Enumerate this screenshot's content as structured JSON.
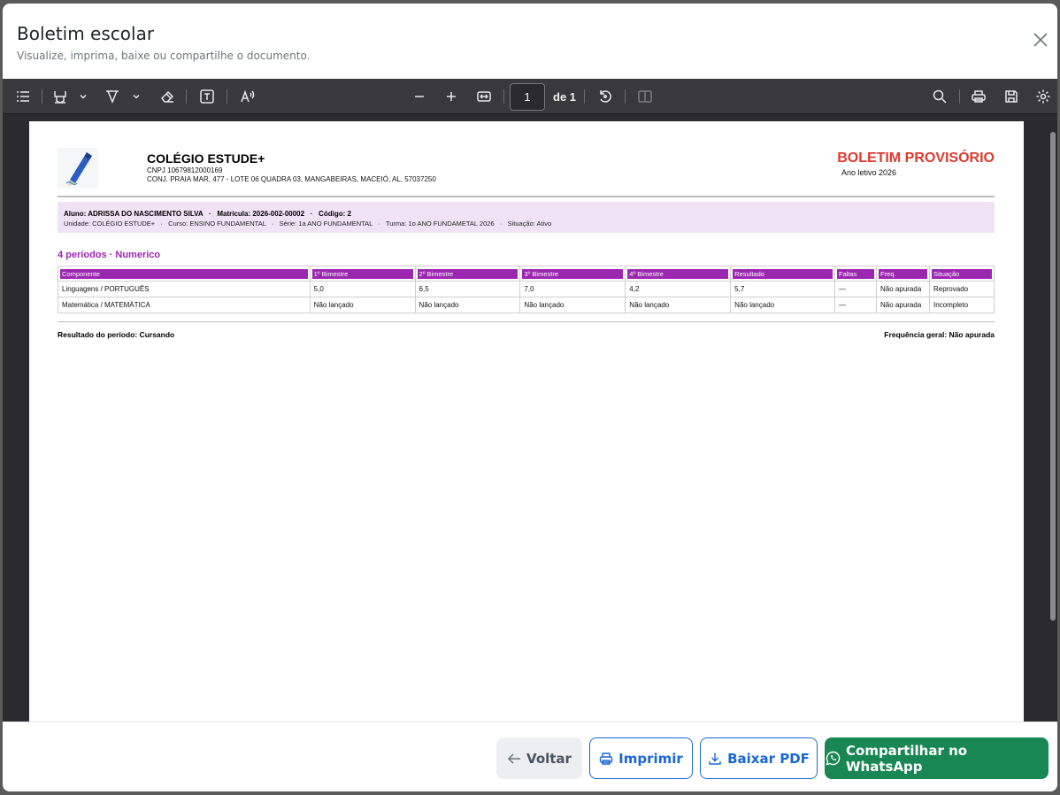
{
  "modal": {
    "title": "Boletim escolar",
    "subtitle": "Visualize, imprima, baixe ou compartilhe o documento."
  },
  "toolbar": {
    "page_current": "1",
    "page_of": "de 1",
    "icons": [
      "sidebar-toggle-icon",
      "highlight-icon",
      "chevron-down-icon",
      "draw-icon",
      "chevron-down-icon",
      "eraser-icon",
      "text-box-icon",
      "read-aloud-icon",
      "zoom-out-icon",
      "zoom-in-icon",
      "fit-page-icon",
      "rotate-icon",
      "page-view-icon",
      "search-icon",
      "print-icon",
      "save-icon",
      "settings-icon"
    ]
  },
  "document": {
    "school_name": "COLÉGIO ESTUDE+",
    "cnpj": "CNPJ 10679812000169",
    "address": "CONJ. PRAIA MAR, 477 - LOTE 06 QUADRA 03, MANGABEIRAS, MACEIÓ, AL, 57037250",
    "title": "BOLETIM PROVISÓRIO",
    "year": "Ano letivo 2026",
    "student_line1": "Aluno: ADRISSA DO NASCIMENTO SILVA   ·   Matrícula: 2026-002-00002   ·   Código: 2",
    "student_line2": "Unidade: COLÉGIO ESTUDE+   ·   Curso: ENSINO FUNDAMENTAL   ·   Série: 1a ANO FUNDAMENTAL   ·   Turma: 1o ANO FUNDAMETAL 2026   ·   Situação: Ativo",
    "periods_label": "4 períodos · Numerico",
    "table": {
      "headers": [
        "Componente",
        "1º Bimestre",
        "2º Bimestre",
        "3º Bimestre",
        "4º Bimestre",
        "Resultado",
        "Faltas",
        "Freq.",
        "Situação"
      ],
      "rows": [
        [
          "Linguagens / PORTUGUÊS",
          "5,0",
          "6,5",
          "7,0",
          "4,2",
          "5,7",
          "—",
          "Não apurada",
          "Reprovado"
        ],
        [
          "Matemática / MATEMÁTICA",
          "Não lançado",
          "Não lançado",
          "Não lançado",
          "Não lançado",
          "Não lançado",
          "—",
          "Não apurada",
          "Incompleto"
        ]
      ]
    },
    "result_period": "Resultado do período: Cursando",
    "frequency_general": "Frequência geral: Não apurada"
  },
  "footer": {
    "back_label": "Voltar",
    "print_label": "Imprimir",
    "pdf_label": "Baixar PDF",
    "whatsapp_label": "Compartilhar no WhatsApp"
  },
  "colors": {
    "accent_purple": "#9b27b0",
    "title_red": "#e03a2f",
    "primary_blue": "#1a67d2",
    "whatsapp_green": "#198754"
  }
}
